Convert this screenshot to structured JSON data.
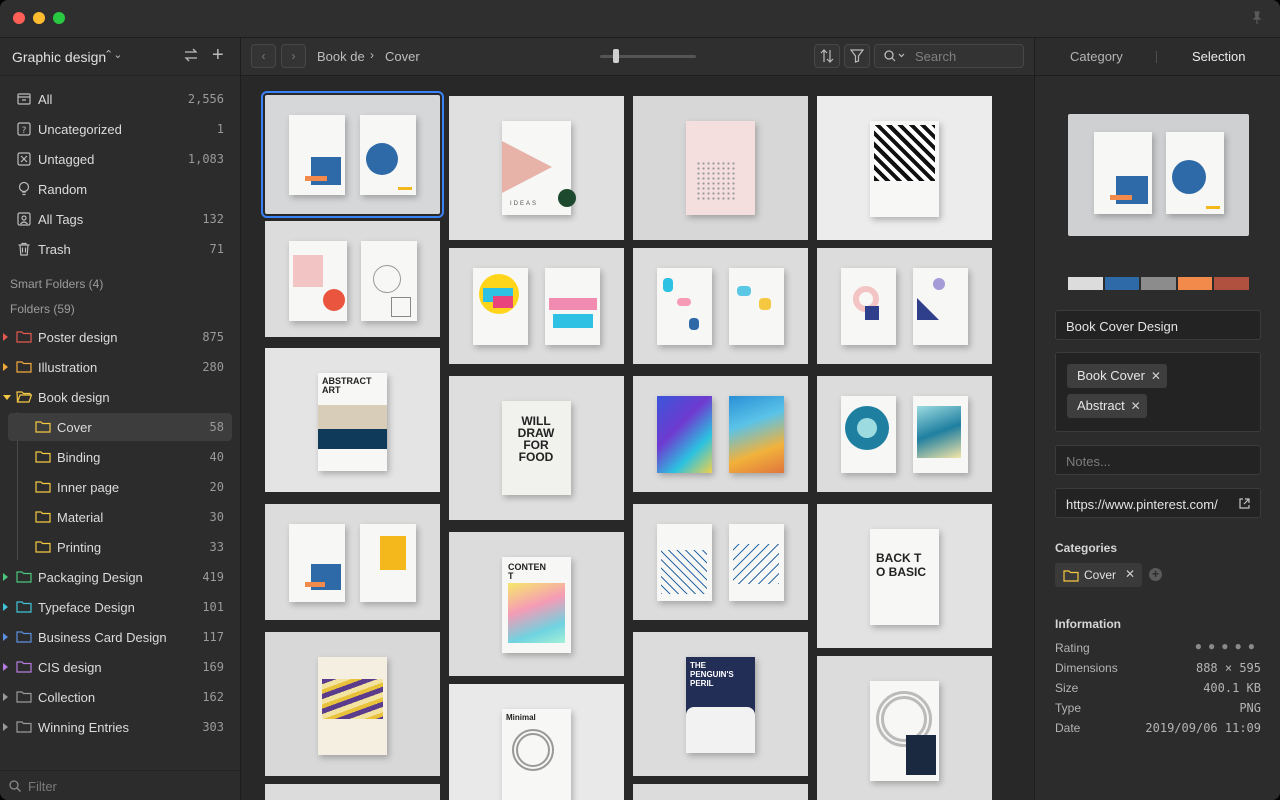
{
  "library": {
    "title": "Graphic design"
  },
  "sidebar": {
    "top_items": [
      {
        "label": "All",
        "count": "2,556",
        "icon": "archive-icon"
      },
      {
        "label": "Uncategorized",
        "count": "1",
        "icon": "question-box-icon"
      },
      {
        "label": "Untagged",
        "count": "1,083",
        "icon": "untagged-icon"
      },
      {
        "label": "Random",
        "count": "",
        "icon": "lightbulb-icon"
      },
      {
        "label": "All Tags",
        "count": "132",
        "icon": "tag-frame-icon"
      },
      {
        "label": "Trash",
        "count": "71",
        "icon": "trash-icon"
      }
    ],
    "smart_folders": "Smart Folders (4)",
    "folders_heading": "Folders (59)",
    "folders": [
      {
        "label": "Poster design",
        "count": "875",
        "color": "#e5574f"
      },
      {
        "label": "Illustration",
        "count": "280",
        "color": "#f2a93b"
      },
      {
        "label": "Book design",
        "count": "",
        "color": "#f5c842"
      },
      {
        "label": "Cover",
        "count": "58",
        "color": "#f5c842"
      },
      {
        "label": "Binding",
        "count": "40",
        "color": "#f5c842"
      },
      {
        "label": "Inner page",
        "count": "20",
        "color": "#f5c842"
      },
      {
        "label": "Material",
        "count": "30",
        "color": "#f5c842"
      },
      {
        "label": "Printing",
        "count": "33",
        "color": "#f5c842"
      },
      {
        "label": "Packaging Design",
        "count": "419",
        "color": "#4bc67d"
      },
      {
        "label": "Typeface Design",
        "count": "101",
        "color": "#3fc4d8"
      },
      {
        "label": "Business Card Design",
        "count": "117",
        "color": "#5c8fe0"
      },
      {
        "label": "CIS design",
        "count": "169",
        "color": "#b57be0"
      },
      {
        "label": "Collection",
        "count": "162",
        "color": "#9a9a9a"
      },
      {
        "label": "Winning Entries",
        "count": "303",
        "color": "#9a9a9a"
      }
    ],
    "filter_placeholder": "Filter"
  },
  "toolbar": {
    "breadcrumb_parent": "Book de",
    "breadcrumb_current": "Cover",
    "search_placeholder": "Search",
    "zoom": 0.15
  },
  "inspector": {
    "tab_category": "Category",
    "tab_selection": "Selection",
    "palette": [
      "#dcdcdc",
      "#2f6aa8",
      "#8c8c8c",
      "#f28a4b",
      "#b0503f"
    ],
    "name": "Book Cover Design",
    "tags": [
      "Book Cover",
      "Abstract"
    ],
    "notes_placeholder": "Notes...",
    "url": "https://www.pinterest.com/",
    "categories_heading": "Categories",
    "category_chip": "Cover",
    "information_heading": "Information",
    "info": {
      "rating_label": "Rating",
      "rating_value": 0,
      "dimensions_label": "Dimensions",
      "dimensions": "888 × 595",
      "size_label": "Size",
      "size": "400.1 KB",
      "type_label": "Type",
      "type": "PNG",
      "date_label": "Date",
      "date": "2019/09/06 11:09"
    }
  },
  "grid_text": {
    "ideas": "IDEAS",
    "will_draw": "WILL DRAW FOR FOOD",
    "content": "CONTENT",
    "penguin": "THE PENGUIN'S PERIL",
    "back_to_basic": "BACK TO BASIC",
    "abstract_art": "ABSTRACT ART",
    "minimal": "Minimal"
  }
}
